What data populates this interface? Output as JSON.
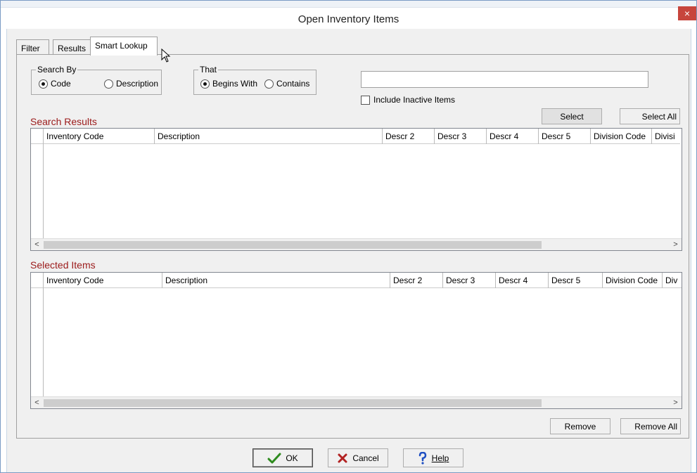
{
  "window": {
    "title": "Open Inventory Items",
    "close_label": "×"
  },
  "tabs": [
    {
      "label": "Filter"
    },
    {
      "label": "Results"
    },
    {
      "label": "Smart Lookup"
    }
  ],
  "search_by": {
    "title": "Search By",
    "options": [
      {
        "label": "Code",
        "selected": true
      },
      {
        "label": "Description",
        "selected": false
      }
    ]
  },
  "that": {
    "title": "That",
    "options": [
      {
        "label": "Begins With",
        "selected": true
      },
      {
        "label": "Contains",
        "selected": false
      }
    ]
  },
  "search": {
    "value": "",
    "include_inactive_label": "Include Inactive Items",
    "include_inactive_checked": false
  },
  "search_results": {
    "label": "Search Results",
    "select_button": "Select",
    "select_all_button": "Select All",
    "columns": [
      "Inventory Code",
      "Description",
      "Descr 2",
      "Descr 3",
      "Descr 4",
      "Descr 5",
      "Division Code",
      "Divisi"
    ]
  },
  "selected_items": {
    "label": "Selected Items",
    "remove_button": "Remove",
    "remove_all_button": "Remove All",
    "columns": [
      "Inventory Code",
      "Description",
      "Descr 2",
      "Descr 3",
      "Descr 4",
      "Descr 5",
      "Division Code",
      "Div"
    ]
  },
  "scroll": {
    "left": "<",
    "right": ">"
  },
  "footer": {
    "ok": "OK",
    "cancel": "Cancel",
    "help": "Help"
  },
  "icons": {
    "ok": "checkmark-icon",
    "cancel": "x-icon",
    "help": "question-icon"
  },
  "colors": {
    "section_label": "#9b1a1a",
    "close_button": "#c7453c",
    "ok_check": "#2e8b1e",
    "cancel_x": "#b22222",
    "help_q": "#1f4fc2"
  }
}
